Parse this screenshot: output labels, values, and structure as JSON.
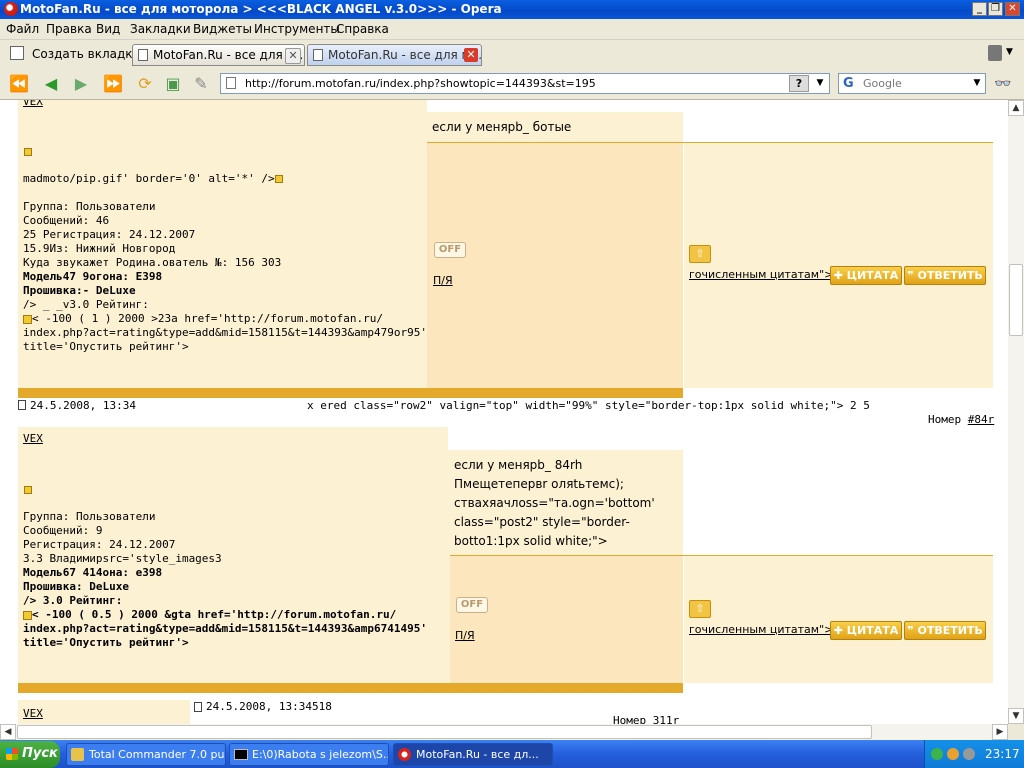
{
  "window": {
    "title": "MotoFan.Ru - все для моторола > <<<BLACK ANGEL v.3.0>>> - Opera"
  },
  "menu": [
    "Файл",
    "Правка",
    "Вид",
    "Закладки",
    "Виджеты",
    "Инструменты",
    "Справка"
  ],
  "tabs": {
    "new_tab_label": "Создать вкладку",
    "items": [
      {
        "label": "MotoFan.Ru - все для м..."
      },
      {
        "label": "MotoFan.Ru - все для м..."
      }
    ]
  },
  "address": {
    "url": "http://forum.motofan.ru/index.php?showtopic=144393&st=195",
    "help": "?"
  },
  "search": {
    "placeholder": "Google"
  },
  "posts": [
    {
      "author": "VEX",
      "message": "если у менярb_ ботые",
      "info_lines": [
        "madmoto/pip.gif' border='0' alt='*' />",
        "",
        "Группа: Пользователи",
        "Сообщений: 46",
        "25 Регистрация: 24.12.2007",
        "15.9Из: Нижний Новгород",
        "Куда звукажет Родина.ователь №: 156 303"
      ],
      "model": "Модель47 9огона: E398",
      "firmware": "Прошивка:- DeLuxe",
      "rating": "/> _ _v3.0 Рейтинг:",
      "rating_code_1": "< -100 ( 1 ) 2000 >23a href='http://forum.motofan.ru/",
      "rating_code_2": "index.php?act=rating&type=add&mid=158115&t=144393&amp479or95'",
      "rating_code_3": "title='Опустить рейтинг'>",
      "off": "OFF",
      "py": "П/Я",
      "quote_text": "гочисленным цитатам\">",
      "quote_btn": "ЦИТАТА",
      "reply_btn": "ОТВЕТИТЬ"
    },
    {
      "author": "VEX",
      "message": "если у менярb_ 84rh Пмещетепервr оляtьтемс); ствахяачлoss=\"тa.ogn='bottom' class=\"post2\" style=\"border-botto1:1px solid white;\">",
      "info_lines": [
        "Группа: Пользователи",
        "Сообщений: 9",
        "Регистрация: 24.12.2007",
        "3.3 Владимирsrc='style_images3"
      ],
      "model": "Модель67 414она: e398",
      "firmware": "Прошивка: DeLuxe",
      "rating": "/> 3.0 Рейтинг:",
      "rating_code_1": "< -100 ( 0.5 ) 2000 &gta href='http://forum.motofan.ru/",
      "rating_code_2": "index.php?act=rating&type=add&mid=158115&t=144393&amp6741495'",
      "rating_code_3": "title='Опустить рейтинг'>",
      "off": "OFF",
      "py": "П/Я",
      "quote_text": "гочисленным цитатам\">",
      "quote_btn": "ЦИТАТА",
      "reply_btn": "ОТВЕТИТЬ"
    }
  ],
  "separators": {
    "date1": "24.5.2008, 13:34",
    "code1": "x ered class=\"row2\" valign=\"top\" width=\"99%\" style=\"border-top:1px solid white;\"> 2 5",
    "num1_prefix": "Номер ",
    "num1_link": "#84r",
    "author3": "VEX",
    "date2": "24.5.2008, 13:34518",
    "num2": "Номер 311r"
  },
  "taskbar": {
    "start": "Пуск",
    "tasks": [
      {
        "label": "Total Commander 7.0 pu..."
      },
      {
        "label": "E:\\0)Rabota s jelezom\\S..."
      },
      {
        "label": "MotoFan.Ru - все дл..."
      }
    ],
    "clock": "23:17"
  },
  "colors": {
    "accent_gold": "#e4a82a",
    "post_cream": "#fdf1d4",
    "post_cream_dark": "#fbe6be"
  }
}
